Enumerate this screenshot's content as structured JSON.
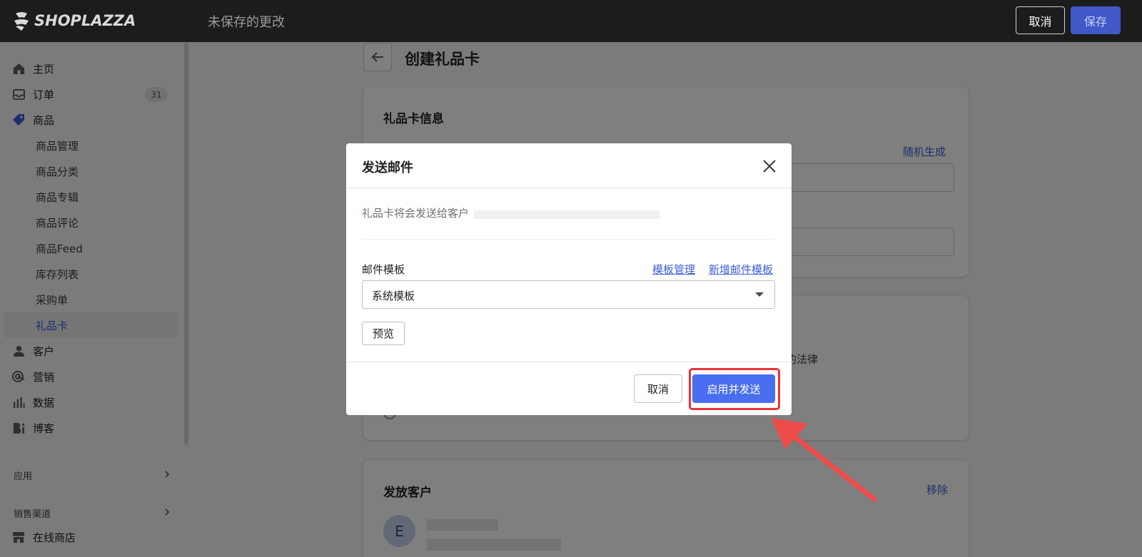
{
  "topbar": {
    "brand": "SHOPLAZZA",
    "unsaved": "未保存的更改",
    "cancel": "取消",
    "save": "保存"
  },
  "sidebar": {
    "home": "主页",
    "orders": "订单",
    "orders_badge": "31",
    "products": "商品",
    "product_subitems": [
      "商品管理",
      "商品分类",
      "商品专辑",
      "商品评论",
      "商品Feed",
      "库存列表",
      "采购单",
      "礼品卡"
    ],
    "customers": "客户",
    "marketing": "营销",
    "analytics": "数据",
    "blog": "博客",
    "apps": "应用",
    "sales_channels": "销售渠道",
    "online_store": "在线商店"
  },
  "page": {
    "title": "创建礼品卡",
    "card1_title": "礼品卡信息",
    "random_generate": "随机生成",
    "law_text": "的法律",
    "card3_title": "发放客户",
    "remove": "移除",
    "avatar_initial": "E"
  },
  "modal": {
    "title": "发送邮件",
    "message": "礼品卡将会发送给客户",
    "template_label": "邮件模板",
    "template_manage": "模板管理",
    "new_template": "新增邮件模板",
    "selected_template": "系统模板",
    "preview": "预览",
    "cancel": "取消",
    "confirm": "启用并发送"
  },
  "colors": {
    "accent": "#4a6ef0",
    "link": "#3b5fd6",
    "highlight": "#e8343a",
    "topbar": "#1c1c1c"
  }
}
